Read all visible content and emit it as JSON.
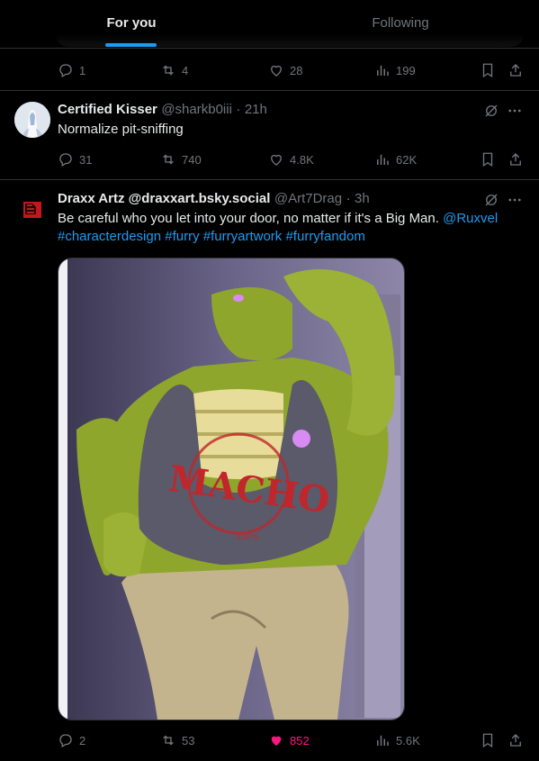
{
  "tabs": {
    "for_you": "For you",
    "following": "Following"
  },
  "post0": {
    "replies": "1",
    "reposts": "4",
    "likes": "28",
    "views": "199"
  },
  "post1": {
    "author_name": "Certified Kisser",
    "handle": "@sharkb0iii",
    "separator": "·",
    "time": "21h",
    "text": "Normalize pit-sniffing",
    "replies": "31",
    "reposts": "740",
    "likes": "4.8K",
    "views": "62K"
  },
  "post2": {
    "author_name": "Draxx Artz @draxxart.bsky.social",
    "handle": "@Art7Drag",
    "separator": "·",
    "time": "3h",
    "text_plain": "Be careful who you let into your door, no matter if it's a Big Man. ",
    "mention": "@Ruxvel",
    "hashtags": [
      "#characterdesign",
      "#furry",
      "#furryartwork",
      "#furryfandom"
    ],
    "image_shirt_text": "MACHO",
    "image_shirt_small": "100%",
    "replies": "2",
    "reposts": "53",
    "likes": "852",
    "views": "5.6K"
  },
  "colors": {
    "accent": "#1d9bf0",
    "like_active": "#f91880",
    "muted": "#71767b",
    "text": "#e7e9ea"
  }
}
